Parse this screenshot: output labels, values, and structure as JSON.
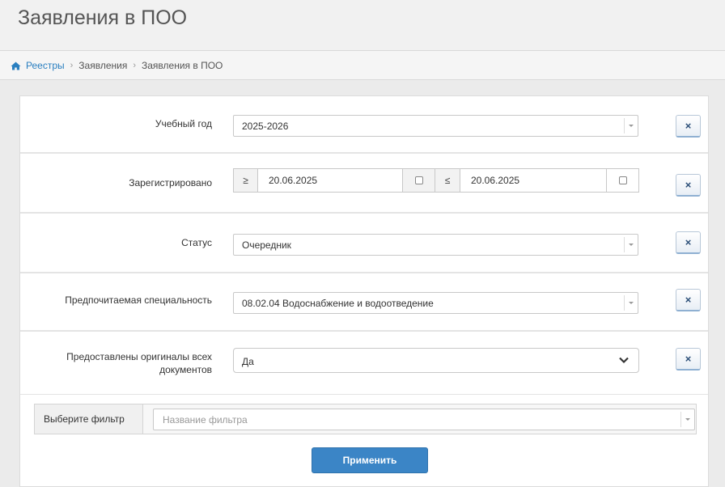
{
  "page": {
    "title": "Заявления в ПОО"
  },
  "breadcrumb": {
    "home_icon": "home-icon",
    "items": [
      "Реестры",
      "Заявления",
      "Заявления в ПОО"
    ],
    "separator": "›"
  },
  "filters": {
    "academic_year": {
      "label": "Учебный год",
      "value": "2025-2026"
    },
    "registered": {
      "label": "Зарегистрировано",
      "from_op": "≥",
      "from_value": "20.06.2025",
      "to_op": "≤",
      "to_value": "20.06.2025"
    },
    "status": {
      "label": "Статус",
      "value": "Очередник"
    },
    "specialty": {
      "label": "Предпочитаемая специальность",
      "value": "08.02.04 Водоснабжение и водоотведение"
    },
    "originals": {
      "label_line1": "Предоставлены оригиналы всех",
      "label_line2": "документов",
      "value": "Да"
    },
    "clear_label": "×"
  },
  "filter_picker": {
    "label": "Выберите фильтр",
    "placeholder": "Название фильтра"
  },
  "apply_label": "Применить",
  "colors": {
    "accent": "#3b85c6",
    "link": "#2a7fc0"
  }
}
